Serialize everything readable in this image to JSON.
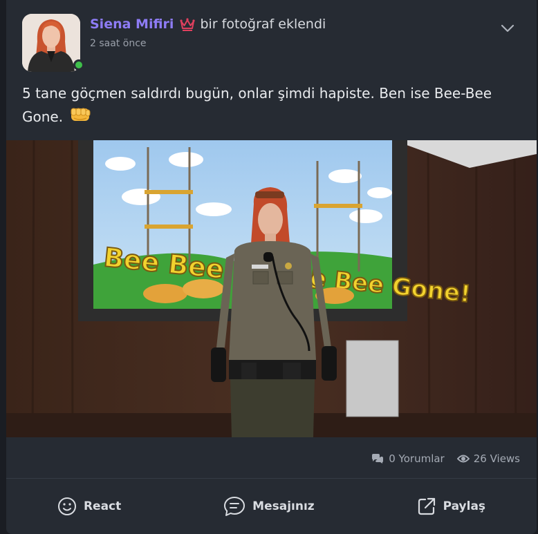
{
  "post": {
    "author": "Siena Mifiri",
    "action": "bir fotoğraf eklendi",
    "time": "2 saat önce",
    "text": "5 tane göçmen saldırdı bugün, onlar şimdi hapiste. Ben ise Bee-Bee Gone."
  },
  "image": {
    "screen_text_left": "Bee Bee Gone!",
    "screen_text_right": "Bee Bee Gone!"
  },
  "stats": {
    "comments": "0 Yorumlar",
    "views": "26 Views"
  },
  "actions": {
    "react": "React",
    "comment": "Mesajınız",
    "share": "Paylaş"
  },
  "colors": {
    "background": "#1a1d23",
    "card": "#262b33",
    "author_name": "#8e7cf5",
    "crown": "#e0405e",
    "online": "#3fbf4a"
  },
  "icons": [
    "crown-icon",
    "chevron-down-icon",
    "fist-emoji-icon",
    "comments-icon",
    "eye-icon",
    "smile-icon",
    "message-icon",
    "share-icon"
  ]
}
